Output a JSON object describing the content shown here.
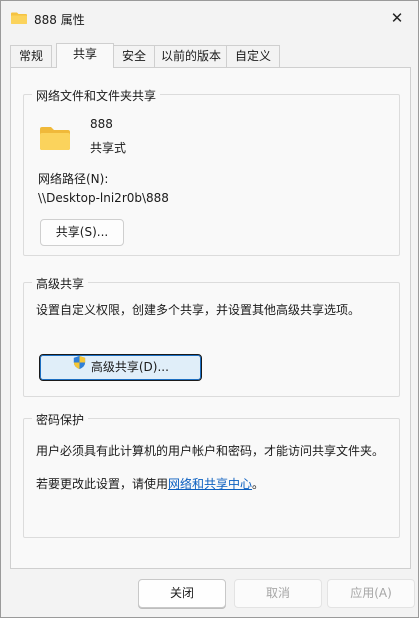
{
  "window": {
    "title": "888 属性",
    "close_glyph": "✕"
  },
  "tabs": [
    {
      "label": "常规",
      "active": false
    },
    {
      "label": "共享",
      "active": true
    },
    {
      "label": "安全",
      "active": false
    },
    {
      "label": "以前的版本",
      "active": false
    },
    {
      "label": "自定义",
      "active": false
    }
  ],
  "network_sharing": {
    "title": "网络文件和文件夹共享",
    "folder_name": "888",
    "status": "共享式",
    "path_label": "网络路径(N):",
    "path_value": "\\\\Desktop-lni2r0b\\888",
    "share_button": "共享(S)..."
  },
  "advanced_sharing": {
    "title": "高级共享",
    "description": "设置自定义权限，创建多个共享，并设置其他高级共享选项。",
    "button": "高级共享(D)..."
  },
  "password_protection": {
    "title": "密码保护",
    "description": "用户必须具有此计算机的用户帐户和密码，才能访问共享文件夹。",
    "change_prefix": "若要更改此设置，请使用",
    "link": "网络和共享中心",
    "change_suffix": "。"
  },
  "footer": {
    "close": "关闭",
    "cancel": "取消",
    "apply": "应用(A)"
  },
  "colors": {
    "link": "#0b5fc0",
    "folder": "#f7c948",
    "focus_border": "#1b6ec2"
  },
  "icons": {
    "folder": "folder-icon",
    "shield": "uac-shield-icon",
    "close": "close-icon"
  }
}
